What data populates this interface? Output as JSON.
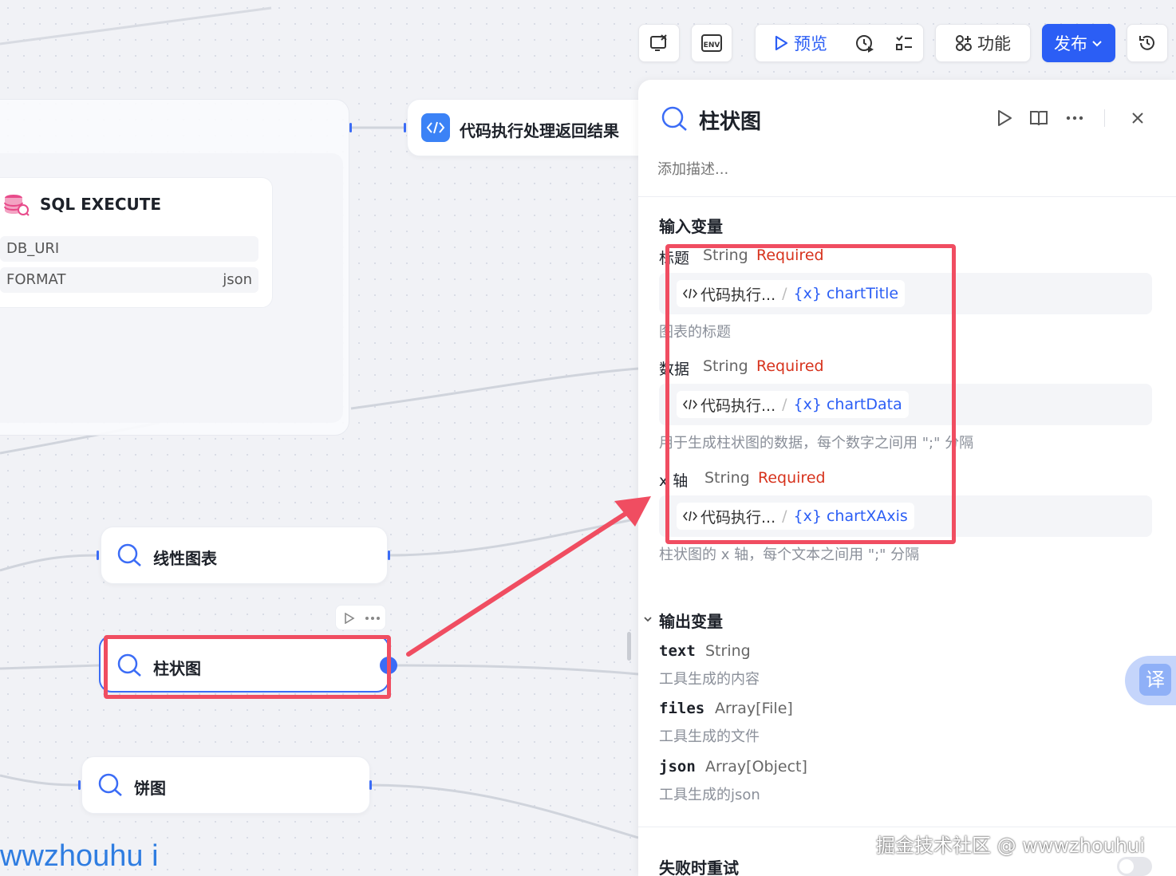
{
  "toolbar": {
    "preview_label": "预览",
    "features_label": "功能",
    "publish_label": "发布",
    "env_label": "ENV"
  },
  "canvas": {
    "code_node_title": "代码执行处理返回结果",
    "sql_node": {
      "title": "SQL EXECUTE",
      "rows": [
        {
          "label": "DB_URI",
          "value": ""
        },
        {
          "label": "FORMAT",
          "value": "json"
        }
      ]
    },
    "line_chart_node_title": "线性图表",
    "bar_chart_node_title": "柱状图",
    "pie_chart_node_title": "饼图",
    "watermark_left": "wwzhouhu i"
  },
  "panel": {
    "title": "柱状图",
    "description_placeholder": "添加描述...",
    "inputs_title": "输入变量",
    "inputs": [
      {
        "name": "标题",
        "type": "String",
        "required": "Required",
        "source": "代码执行...",
        "var": "chartTitle",
        "desc": "图表的标题"
      },
      {
        "name": "数据",
        "type": "String",
        "required": "Required",
        "source": "代码执行...",
        "var": "chartData",
        "desc": "用于生成柱状图的数据，每个数字之间用 \";\" 分隔"
      },
      {
        "name": "x 轴",
        "type": "String",
        "required": "Required",
        "source": "代码执行...",
        "var": "chartXAxis",
        "desc": "柱状图的 x 轴，每个文本之间用 \";\" 分隔"
      }
    ],
    "outputs_title": "输出变量",
    "outputs": [
      {
        "name": "text",
        "type": "String",
        "desc": "工具生成的内容"
      },
      {
        "name": "files",
        "type": "Array[File]",
        "desc": "工具生成的文件"
      },
      {
        "name": "json",
        "type": "Array[Object]",
        "desc": "工具生成的json"
      }
    ],
    "retry_title": "失败时重试"
  },
  "translate_label": "译",
  "watermark_right": "掘金技术社区 @ wwwzhouhui",
  "colors": {
    "accent": "#2b5ef5",
    "required": "#d7331d",
    "highlight": "#f04d61"
  }
}
